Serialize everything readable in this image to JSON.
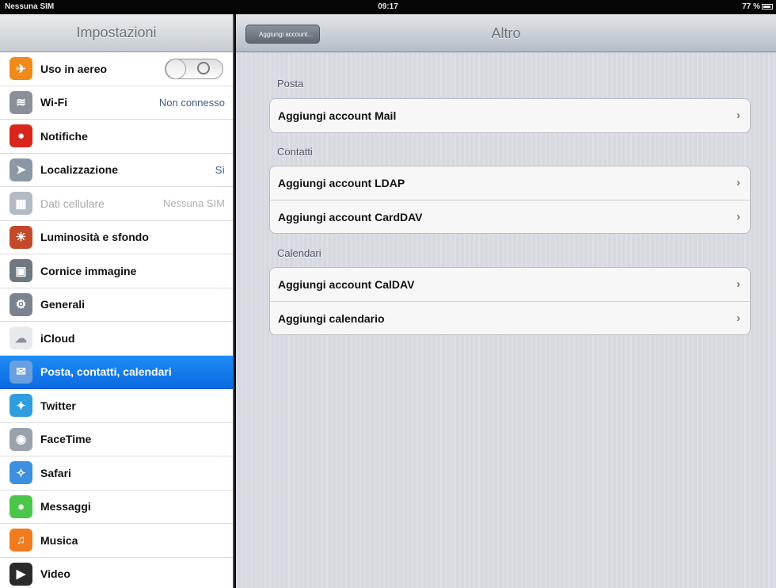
{
  "status_bar": {
    "carrier": "Nessuna SIM",
    "time": "09:17",
    "battery": "77 %"
  },
  "sidebar": {
    "title": "Impostazioni",
    "items": [
      {
        "label": "Uso in aereo",
        "icon": "airplane-icon",
        "color": "#f08a1a",
        "glyph": "✈"
      },
      {
        "label": "Wi-Fi",
        "value": "Non connesso",
        "icon": "wifi-icon",
        "color": "#8a9099",
        "glyph": "≋"
      },
      {
        "label": "Notifiche",
        "icon": "notifications-icon",
        "color": "#d8261d",
        "glyph": "●"
      },
      {
        "label": "Localizzazione",
        "value": "Sì",
        "icon": "location-icon",
        "color": "#8c97a6",
        "glyph": "➤"
      },
      {
        "label": "Dati cellulare",
        "value": "Nessuna SIM",
        "icon": "cellular-icon",
        "color": "#b3bac4",
        "glyph": "▦"
      },
      {
        "label": "Luminosità e sfondo",
        "icon": "brightness-icon",
        "color": "#c24a2a",
        "glyph": "☀"
      },
      {
        "label": "Cornice immagine",
        "icon": "picture-frame-icon",
        "color": "#6f7780",
        "glyph": "▣"
      },
      {
        "label": "Generali",
        "icon": "gear-icon",
        "color": "#7b8390",
        "glyph": "⚙"
      },
      {
        "label": "iCloud",
        "icon": "cloud-icon",
        "color": "#e6e9ed",
        "glyph": "☁"
      },
      {
        "label": "Posta, contatti, calendari",
        "icon": "mail-icon",
        "color": "#6aa0e0",
        "glyph": "✉"
      },
      {
        "label": "Twitter",
        "icon": "twitter-icon",
        "color": "#2f9de0",
        "glyph": "✦"
      },
      {
        "label": "FaceTime",
        "icon": "facetime-icon",
        "color": "#9aa2ab",
        "glyph": "◉"
      },
      {
        "label": "Safari",
        "icon": "safari-icon",
        "color": "#3d8fe0",
        "glyph": "✧"
      },
      {
        "label": "Messaggi",
        "icon": "messages-icon",
        "color": "#4cc64a",
        "glyph": "💬"
      },
      {
        "label": "Musica",
        "icon": "music-icon",
        "color": "#f07c1e",
        "glyph": "♫"
      },
      {
        "label": "Video",
        "icon": "video-icon",
        "color": "#2a2a2a",
        "glyph": "▶"
      }
    ]
  },
  "main": {
    "back_label": "Aggiungi account...",
    "title": "Altro",
    "sections": [
      {
        "label": "Posta",
        "rows": [
          "Aggiungi account Mail"
        ]
      },
      {
        "label": "Contatti",
        "rows": [
          "Aggiungi account LDAP",
          "Aggiungi account CardDAV"
        ]
      },
      {
        "label": "Calendari",
        "rows": [
          "Aggiungi account CalDAV",
          "Aggiungi calendario"
        ]
      }
    ],
    "chevron": "›"
  }
}
